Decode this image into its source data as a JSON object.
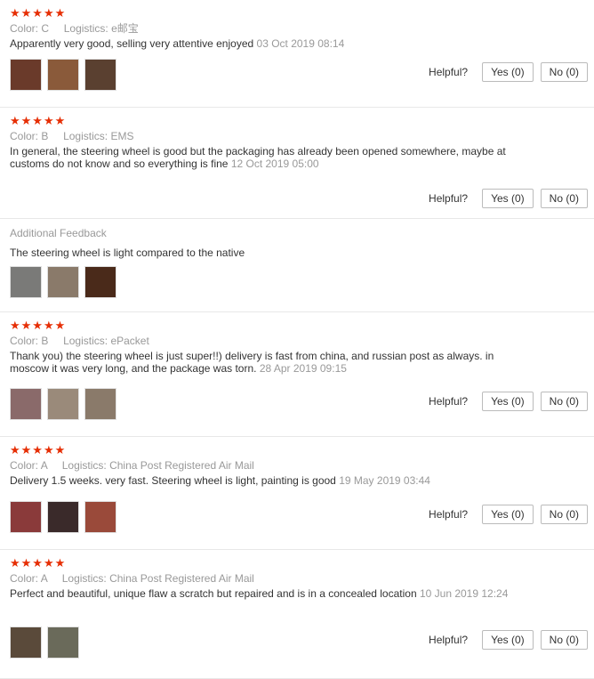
{
  "labels": {
    "color": "Color:",
    "logistics": "Logistics:",
    "helpful": "Helpful?",
    "yes": "Yes (0)",
    "no": "No (0)",
    "additional_feedback": "Additional Feedback"
  },
  "colors": {
    "stars": "#e62e04",
    "muted": "#999999",
    "text": "#333333"
  },
  "reviews": [
    {
      "stars": "★★★★★",
      "color": "C",
      "logistics": "e邮宝",
      "text": "Apparently very good, selling very attentive enjoyed",
      "date": "03 Oct 2019 08:14",
      "photo_colors": [
        "#6a3a2a",
        "#8a5a3a",
        "#5a4030"
      ]
    },
    {
      "stars": "★★★★★",
      "color": "B",
      "logistics": "EMS",
      "text": "In general, the steering wheel is good but the packaging has already been opened somewhere, maybe at customs do not know and so everything is fine",
      "date": "12 Oct 2019 05:00",
      "additional_text": "The steering wheel is light compared to the native",
      "additional_photo_colors": [
        "#7a7a78",
        "#8a7a6a",
        "#4a2a1a"
      ]
    },
    {
      "stars": "★★★★★",
      "color": "B",
      "logistics": "ePacket",
      "text": "Thank you) the steering wheel is just super!!) delivery is fast from china, and russian post as always. in moscow it was very long, and the package was torn.",
      "date": "28 Apr 2019 09:15",
      "photo_colors": [
        "#8a6a6a",
        "#9a8a7a",
        "#8a7a6a"
      ]
    },
    {
      "stars": "★★★★★",
      "color": "A",
      "logistics": "China Post Registered Air Mail",
      "text": "Delivery 1.5 weeks. very fast. Steering wheel is light, painting is good",
      "date": "19 May 2019 03:44",
      "photo_colors": [
        "#8a3a3a",
        "#3a2a2a",
        "#9a4a3a"
      ]
    },
    {
      "stars": "★★★★★",
      "color": "A",
      "logistics": "China Post Registered Air Mail",
      "text": "Perfect and beautiful, unique flaw a scratch but repaired and is in a concealed location",
      "date": "10 Jun 2019 12:24",
      "photo_colors": [
        "#5a4a3a",
        "#6a6a5a"
      ]
    }
  ]
}
